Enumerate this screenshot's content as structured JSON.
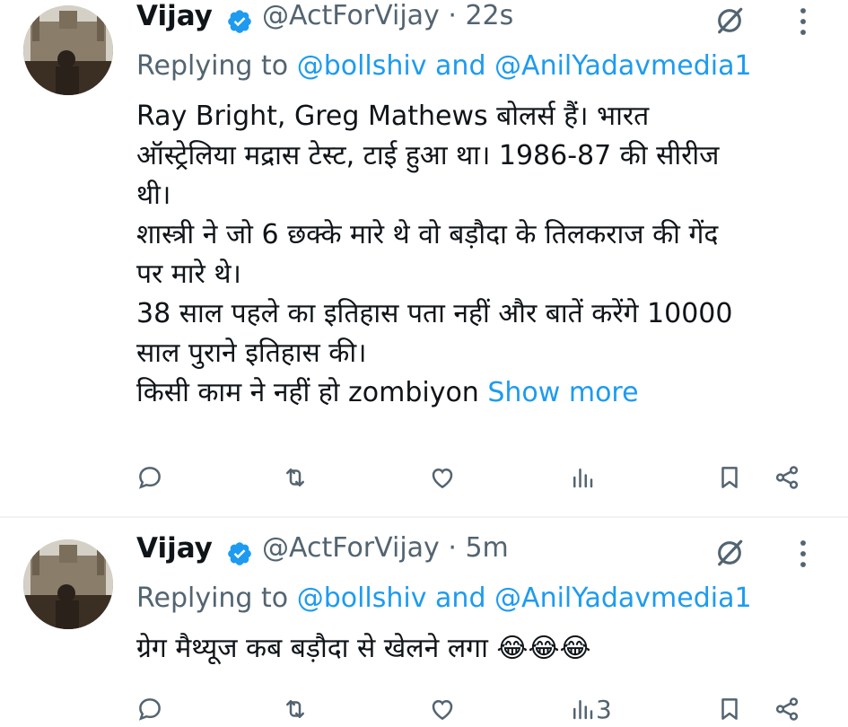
{
  "tweets": [
    {
      "author_name": "Vijay",
      "handle": "@ActForVijay",
      "time_sep": "·",
      "time": "22s",
      "replying_to_label": "Replying to",
      "replying_mention_1": "@bollshiv",
      "replying_and": "and",
      "replying_mention_2": "@AnilYadavmedia1",
      "lines": [
        "Ray Bright, Greg Mathews बोलर्स हैं। भारत",
        "ऑस्ट्रेलिया मद्रास टेस्ट, टाई हुआ था। 1986-87 की सीरीज",
        "थी।",
        "शास्त्री ने जो 6 छक्के मारे थे वो बड़ौदा के तिलकराज की गेंद",
        "पर मारे थे।",
        "38 साल पहले का इतिहास पता नहीं और बातें करेंगे 10000",
        "साल पुराने इतिहास की।"
      ],
      "last_line": "किसी काम ने नहीं हो zombiyon",
      "show_more": "Show more",
      "views_count": ""
    },
    {
      "author_name": "Vijay",
      "handle": "@ActForVijay",
      "time_sep": "·",
      "time": "5m",
      "replying_to_label": "Replying to",
      "replying_mention_1": "@bollshiv",
      "replying_and": "and",
      "replying_mention_2": "@AnilYadavmedia1",
      "text": "ग्रेग मैथ्यूज कब बड़ौदा से खेलने लगा",
      "emoji": "😂😂😂",
      "views_count": "3"
    }
  ],
  "colors": {
    "link": "#1d9bf0",
    "secondary": "#536471",
    "primary": "#0f1419",
    "verified": "#1d9bf0",
    "divider": "#eff3f4"
  },
  "icons": [
    "verified-badge-icon",
    "grok-icon",
    "more-icon",
    "reply-icon",
    "retweet-icon",
    "like-icon",
    "views-icon",
    "bookmark-icon",
    "share-icon"
  ]
}
